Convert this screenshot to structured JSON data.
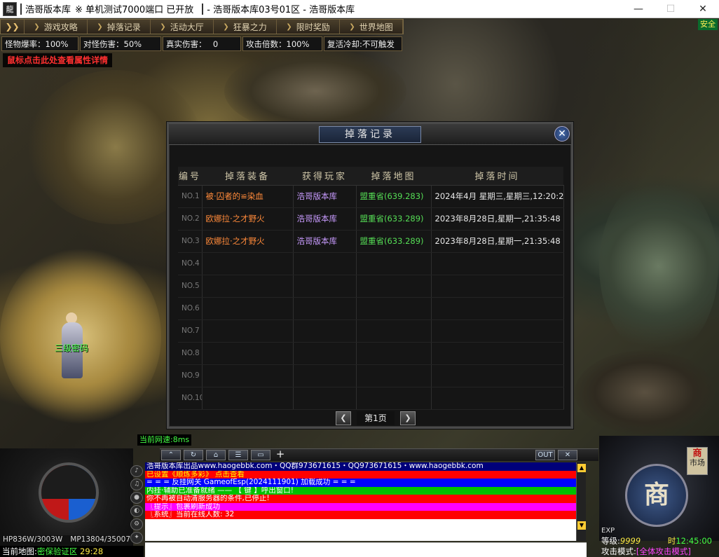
{
  "titlebar": {
    "app_name": "浩哥版本库",
    "subtitle": "※ 单机测试7000端口 已开放",
    "server": "- 浩哥版本库03号01区 - 浩哥版本库",
    "minimize": "—",
    "maximize": "☐",
    "close": "✕"
  },
  "menu": {
    "toggle": "❯❯",
    "items": [
      "游戏攻略",
      "掉落记录",
      "活动大厅",
      "狂暴之力",
      "限时奖励",
      "世界地图"
    ]
  },
  "safe_badge": "安全",
  "stats": [
    "怪物爆率：100%",
    "对怪伤害：50%",
    "真实伤害：　 0",
    "攻击倍数：100%",
    "复活冷却:不可触发"
  ],
  "attr_link": "鼠标点击此处查看属性详情",
  "drop_dialog": {
    "title": "掉落记录",
    "close": "✕",
    "headers": [
      "编号",
      "掉落装备",
      "获得玩家",
      "掉落地图",
      "掉落时间"
    ],
    "rows": [
      {
        "no": "NO.1",
        "item": "被·囚者的≌染血",
        "player": "浩哥版本库",
        "map": "盟重省(639.283)",
        "time": "2024年4月 星期三,星期三,12:20:22"
      },
      {
        "no": "NO.2",
        "item": "欧娜拉·之才野火",
        "player": "浩哥版本库",
        "map": "盟重省(633.289)",
        "time": "2023年8月28日,星期一,21:35:48"
      },
      {
        "no": "NO.3",
        "item": "欧娜拉·之才野火",
        "player": "浩哥版本库",
        "map": "盟重省(633.289)",
        "time": "2023年8月28日,星期一,21:35:48"
      },
      {
        "no": "NO.4",
        "item": "",
        "player": "",
        "map": "",
        "time": ""
      },
      {
        "no": "NO.5",
        "item": "",
        "player": "",
        "map": "",
        "time": ""
      },
      {
        "no": "NO.6",
        "item": "",
        "player": "",
        "map": "",
        "time": ""
      },
      {
        "no": "NO.7",
        "item": "",
        "player": "",
        "map": "",
        "time": ""
      },
      {
        "no": "NO.8",
        "item": "",
        "player": "",
        "map": "",
        "time": ""
      },
      {
        "no": "NO.9",
        "item": "",
        "player": "",
        "map": "",
        "time": ""
      },
      {
        "no": "NO.10",
        "item": "",
        "player": "",
        "map": "",
        "time": ""
      }
    ],
    "page_label": "第1页",
    "prev": "❮",
    "next": "❯"
  },
  "npc_name": "三级密码",
  "net_speed": "当前网速:8ms",
  "chat_tools": {
    "out": "OUT",
    "close": "✕",
    "plus": "+"
  },
  "chat_lines": [
    {
      "text": "浩哥版本库出品www.haogebbk.com・QQ群973671615・QQ973671615・www.haogebbk.com",
      "bg": "#00007a",
      "fg": "#ffffff"
    },
    {
      "text": "已设置《顺炼多彩》 点击查看",
      "bg": "#ff0000",
      "fg": "#ffff00"
    },
    {
      "text": "= = = 反挂网关 GameofEsp(2024111901) 加载成功 = = =",
      "bg": "#0000ff",
      "fg": "#ffffff"
    },
    {
      "text": "内挂·辅助已准备就绪 —— 【 键 】呼出窗口!",
      "bg": "#00c000",
      "fg": "#ffffff"
    },
    {
      "text": "你不再被自动清服务器的条件,已停止!",
      "bg": "#ff0000",
      "fg": "#ffffff"
    },
    {
      "text": "〖提示〗包裹刷新成功",
      "bg": "#ff00ff",
      "fg": "#ffffff"
    },
    {
      "text": "〖系统〗当前在线人数: 32",
      "bg": "#ff0000",
      "fg": "#ffffff"
    }
  ],
  "hp": "HP836W/3003W",
  "mp": "MP13804/35007",
  "current_map": {
    "label": "当前地图:",
    "name": "密保验证区",
    "coords": "29:28"
  },
  "shop": {
    "label": "商",
    "mini_line1": "商",
    "mini_line2": "市场"
  },
  "exp_label": "EXP",
  "level": {
    "label": "等级:",
    "value": "9999",
    "time_label": "时",
    "time": "12:45:00"
  },
  "attack_mode": {
    "label": "攻击模式:",
    "value": "[全体攻击模式]"
  },
  "colors": {
    "accent_gold": "#e0d2b0",
    "green_text": "#44ff44",
    "orange_item": "#ff8a3a",
    "purple_player": "#c99cff"
  }
}
